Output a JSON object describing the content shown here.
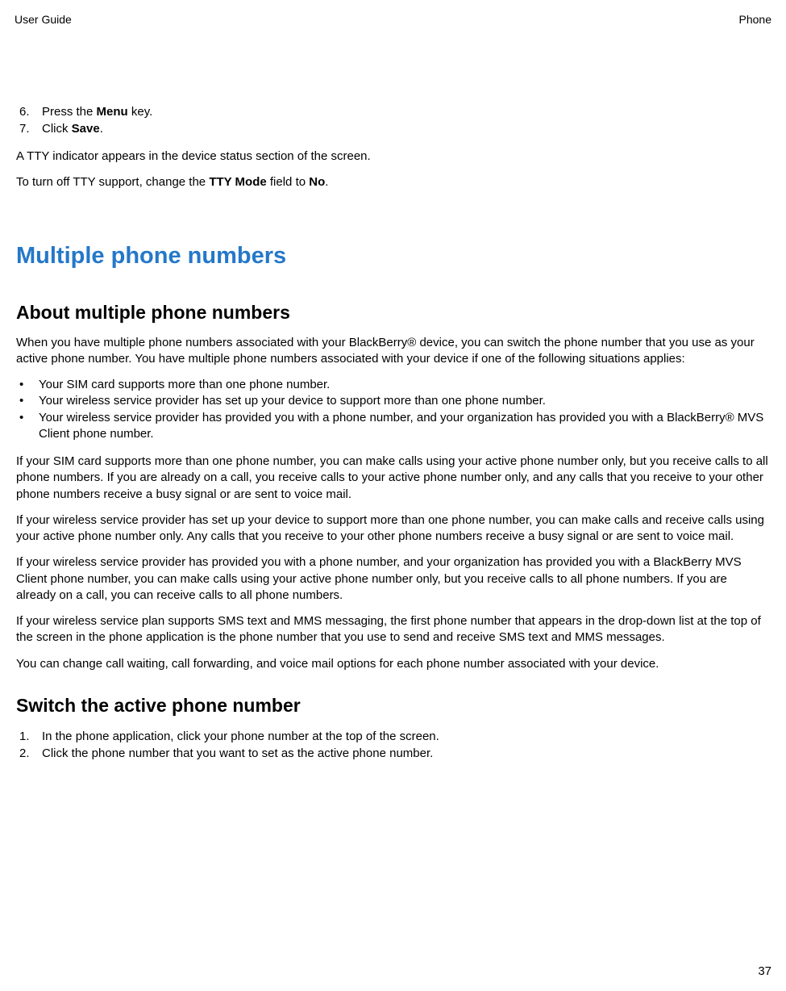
{
  "header": {
    "left": "User Guide",
    "right": "Phone"
  },
  "step6": {
    "num": "6.",
    "pre": "Press the ",
    "bold": "Menu",
    "post": " key."
  },
  "step7": {
    "num": "7.",
    "pre": "Click ",
    "bold": "Save",
    "post": "."
  },
  "para_tty1": "A TTY indicator appears in the device status section of the screen.",
  "para_tty2": {
    "pre": "To turn off TTY support, change the ",
    "bold1": "TTY Mode",
    "mid": " field to ",
    "bold2": "No",
    "post": "."
  },
  "h1": "Multiple phone numbers",
  "h2a": "About multiple phone numbers",
  "para_intro": "When you have multiple phone numbers associated with your BlackBerry® device, you can switch the phone number that you use as your active phone number. You have multiple phone numbers associated with your device if one of the following situations applies:",
  "bullets": {
    "b1": "Your SIM card supports more than one phone number.",
    "b2": "Your wireless service provider has set up your device to support more than one phone number.",
    "b3": "Your wireless service provider has provided you with a phone number, and your organization has provided you with a BlackBerry® MVS Client phone number."
  },
  "para_a": "If your SIM card supports more than one phone number, you can make calls using your active phone number only, but you receive calls to all phone numbers. If you are already on a call, you receive calls to your active phone number only, and any calls that you receive to your other phone numbers receive a busy signal or are sent to voice mail.",
  "para_b": "If your wireless service provider has set up your device to support more than one phone number, you can make calls and receive calls using your active phone number only. Any calls that you receive to your other phone numbers receive a busy signal or are sent to voice mail.",
  "para_c": "If your wireless service provider has provided you with a phone number, and your organization has provided you with a BlackBerry MVS Client phone number, you can make calls using your active phone number only, but you receive calls to all phone numbers. If you are already on a call, you can receive calls to all phone numbers.",
  "para_d": "If your wireless service plan supports SMS text and MMS messaging, the first phone number that appears in the drop-down list at the top of the screen in the phone application is the phone number that you use to send and receive SMS text and MMS messages.",
  "para_e": "You can change call waiting, call forwarding, and voice mail options for each phone number associated with your device.",
  "h2b": "Switch the active phone number",
  "switch1": {
    "num": "1.",
    "text": "In the phone application, click your phone number at the top of the screen."
  },
  "switch2": {
    "num": "2.",
    "text": "Click the phone number that you want to set as the active phone number."
  },
  "page_number": "37"
}
